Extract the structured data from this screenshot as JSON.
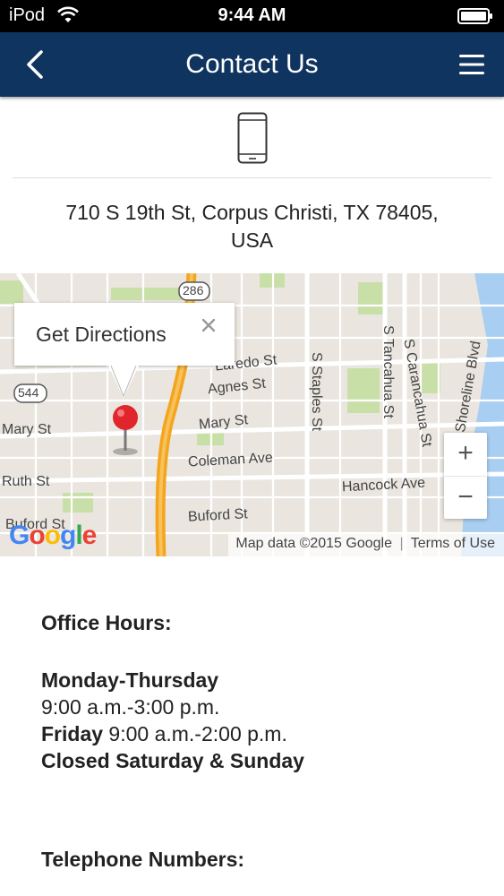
{
  "status_bar": {
    "carrier": "iPod",
    "time": "9:44 AM"
  },
  "nav": {
    "title": "Contact Us",
    "back_icon": "chevron-left-icon",
    "menu_icon": "hamburger-menu-icon"
  },
  "device_icon": "mobile-phone-icon",
  "address": {
    "line1": "710 S 19th St, Corpus Christi, TX 78405,",
    "line2": "USA"
  },
  "map": {
    "popup_label": "Get Directions",
    "popup_close": "×",
    "zoom_in": "+",
    "zoom_out": "−",
    "attribution": "Map data ©2015 Google",
    "terms": "Terms of Use",
    "logo": "Google",
    "labels": {
      "laredo": "Laredo St",
      "agnes": "Agnes St",
      "mary_left": "Mary St",
      "mary_right": "Mary St",
      "ruth": "Ruth St",
      "coleman": "Coleman Ave",
      "buford_left": "Buford St",
      "buford_right": "Buford St",
      "hancock": "Hancock Ave",
      "staples": "S Staples St",
      "tancahua": "S Tancahua St",
      "carancahua": "S Carancahua St",
      "shoreline": "Shoreline Blvd",
      "shield_286": "286",
      "shield_544": "544"
    },
    "colors": {
      "land": "#eae6df",
      "highway": "#f4a520",
      "park": "#c9dfa8",
      "water": "#a8cef2"
    }
  },
  "office_hours": {
    "heading": "Office Hours:",
    "weekday_label": "Monday-Thursday",
    "weekday_hours": "9:00 a.m.-3:00 p.m.",
    "friday_label": "Friday",
    "friday_hours": " 9:00 a.m.-2:00 p.m.",
    "closed": "Closed Saturday & Sunday"
  },
  "telephone": {
    "heading": "Telephone Numbers:"
  }
}
